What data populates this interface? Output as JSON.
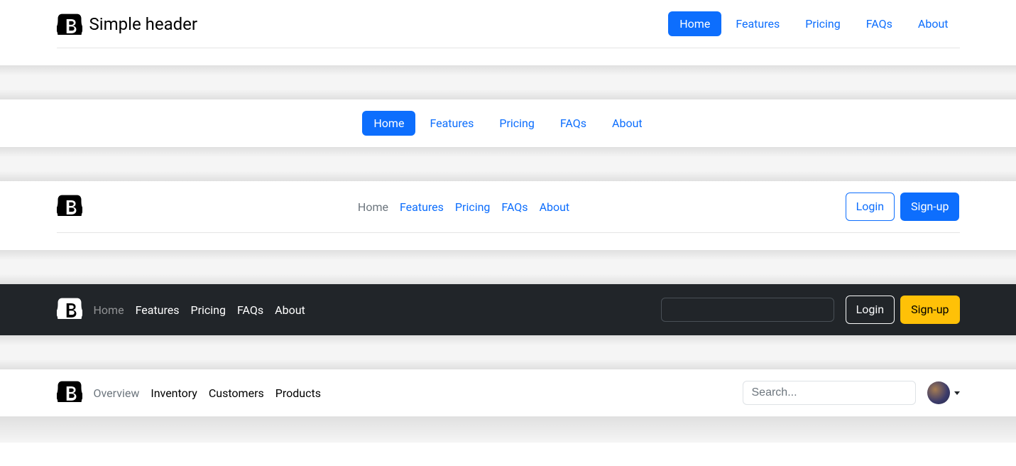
{
  "header1": {
    "title": "Simple header",
    "nav": [
      "Home",
      "Features",
      "Pricing",
      "FAQs",
      "About"
    ]
  },
  "header2": {
    "nav": [
      "Home",
      "Features",
      "Pricing",
      "FAQs",
      "About"
    ]
  },
  "header3": {
    "nav": [
      "Home",
      "Features",
      "Pricing",
      "FAQs",
      "About"
    ],
    "login": "Login",
    "signup": "Sign-up"
  },
  "header4": {
    "nav": [
      "Home",
      "Features",
      "Pricing",
      "FAQs",
      "About"
    ],
    "login": "Login",
    "signup": "Sign-up",
    "search_placeholder": ""
  },
  "header5": {
    "nav": [
      "Overview",
      "Inventory",
      "Customers",
      "Products"
    ],
    "search_placeholder": "Search..."
  }
}
